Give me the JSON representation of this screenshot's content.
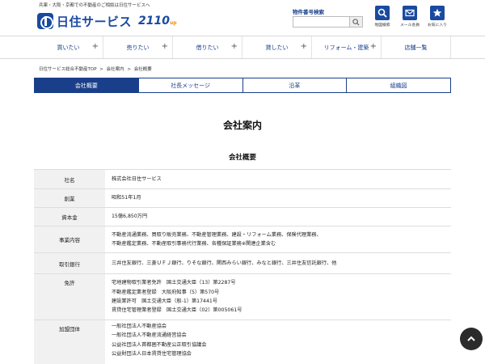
{
  "header": {
    "tagline": "兵庫・大阪・京都での不動産のご相談は日住サービスへ",
    "logo_text": "日住サービス",
    "logo_sub": "2110",
    "logo_sub_small": "up",
    "search": {
      "label": "物件番号検索",
      "value": "",
      "placeholder": ""
    },
    "icons": [
      {
        "label": "地図検索"
      },
      {
        "label": "メール会員"
      },
      {
        "label": "お気に入り"
      }
    ]
  },
  "nav": {
    "items": [
      {
        "label": "買いたい"
      },
      {
        "label": "売りたい"
      },
      {
        "label": "借りたい"
      },
      {
        "label": "貸したい"
      },
      {
        "label": "リフォーム・建築"
      },
      {
        "label": "店舗一覧"
      }
    ]
  },
  "breadcrumb": {
    "items": [
      "日住サービス総合不動産TOP",
      "会社案内",
      "会社概要"
    ],
    "sep": ">"
  },
  "subtabs": [
    {
      "label": "会社概要"
    },
    {
      "label": "社長メッセージ"
    },
    {
      "label": "沿革"
    },
    {
      "label": "組織図"
    }
  ],
  "page_title": "会社案内",
  "section_title": "会社概要",
  "table": {
    "rows": [
      {
        "label": "社名",
        "lines": [
          "株式会社日住サービス"
        ]
      },
      {
        "label": "創業",
        "lines": [
          "昭和51年1月"
        ]
      },
      {
        "label": "資本金",
        "lines": [
          "15億6,850万円"
        ]
      },
      {
        "label": "事業内容",
        "lines": [
          "不動産流通業務、買取り販売業務、不動産管理業務、建設・リフォーム業務、保険代理業務、",
          "不動産鑑定業務、不動産取引事務代行業務、各種保証業務※関連企業含む"
        ]
      },
      {
        "label": "取引銀行",
        "lines": [
          "三井住友銀行、三菱ＵＦＪ銀行、りそな銀行、関西みらい銀行、みなと銀行、三井住友信託銀行、他"
        ]
      },
      {
        "label": "免許",
        "lines": [
          "宅地建物取引業者免許　国土交通大臣（13）第2287号",
          "不動産鑑定業者登録　大阪府知事（5）第570号",
          "建設業許可　国土交通大臣（般-1）第17441号",
          "賃貸住宅管理業者登録　国土交通大臣（02）第005061号"
        ]
      },
      {
        "label": "加盟団体",
        "lines": [
          "一般社団法人不動産協会",
          "一般社団法人不動産流通経営協会",
          "公益社団法人首都圏不動産公正取引協議会",
          "公益財団法人日本賃貸住宅管理協会"
        ]
      }
    ]
  },
  "colors": {
    "brand": "#1a4aa0",
    "nav_text": "#1a3f8a",
    "active_tab": "#1a3f8a",
    "th_bg": "#f1f1f1"
  }
}
